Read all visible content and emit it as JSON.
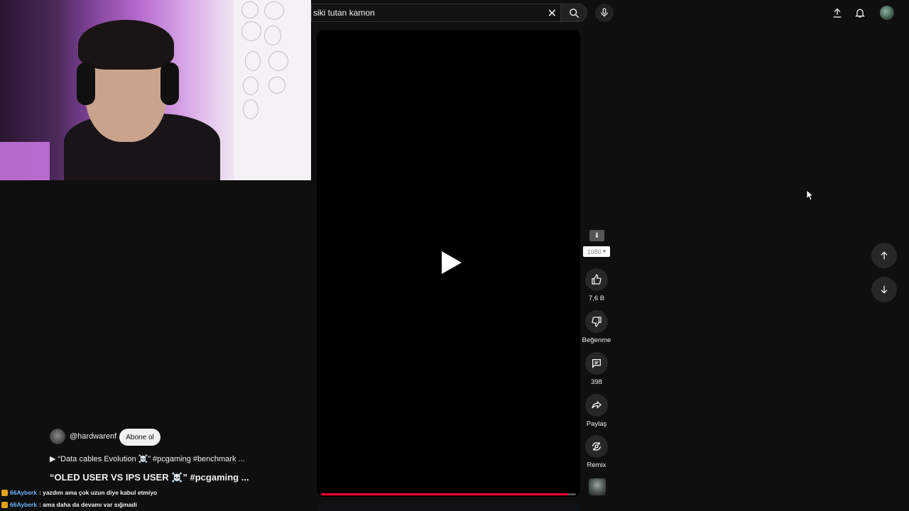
{
  "search": {
    "value": "siki tutan kamon"
  },
  "player": {
    "progress_fraction": 0.97,
    "progress_color": "#ff0033"
  },
  "quality": {
    "label": "1080"
  },
  "actions": [
    {
      "id": "like",
      "label": "7,6 B",
      "icon": "thumbs-up-icon"
    },
    {
      "id": "dislike",
      "label": "Beğenme",
      "icon": "thumbs-down-icon"
    },
    {
      "id": "comments",
      "label": "398",
      "icon": "comment-icon"
    },
    {
      "id": "share",
      "label": "Paylaş",
      "icon": "share-icon"
    },
    {
      "id": "remix",
      "label": "Remix",
      "icon": "remix-icon"
    }
  ],
  "channel": {
    "handle": "@hardwarenf",
    "subscribe_label": "Abone ol"
  },
  "music": {
    "text": "▶ “Data cables Evolution ☠️” #pcgaming #benchmark ..."
  },
  "video": {
    "title": "“OLED USER VS IPS USER ☠️” #pcgaming ..."
  },
  "chat": [
    {
      "user": "66Ayberk",
      "message": ": yazdım ama çok uzun diye kabul etmiyo"
    },
    {
      "user": "66Ayberk",
      "message": ": ama daha da devamı var sığmadi"
    }
  ]
}
